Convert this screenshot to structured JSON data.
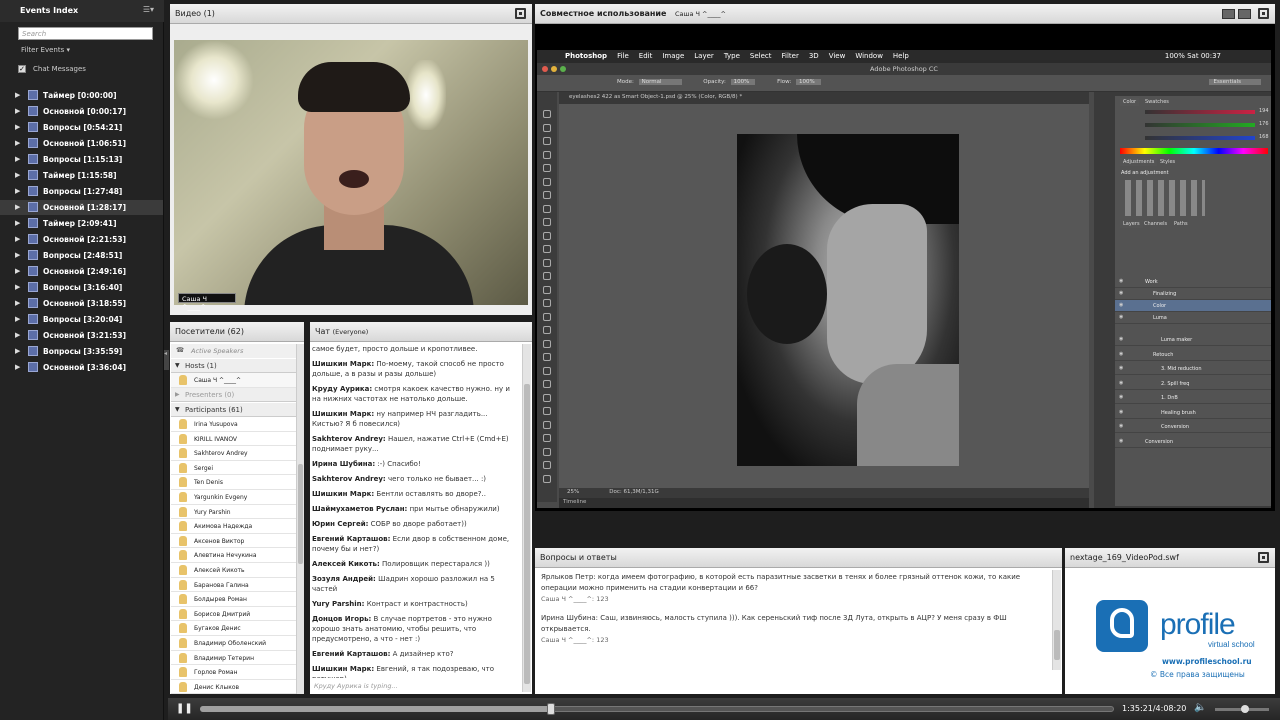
{
  "left_panel": {
    "title": "Events Index",
    "menu_glyph": "☰▾",
    "search_placeholder": "Search",
    "filter_label": "Filter Events",
    "chat_messages_label": "Chat Messages",
    "events": [
      {
        "label": "Таймер [0:00:00]"
      },
      {
        "label": "Основной [0:00:17]"
      },
      {
        "label": "Вопросы [0:54:21]"
      },
      {
        "label": "Основной [1:06:51]"
      },
      {
        "label": "Вопросы [1:15:13]"
      },
      {
        "label": "Таймер [1:15:58]"
      },
      {
        "label": "Вопросы [1:27:48]"
      },
      {
        "label": "Основной [1:28:17]",
        "selected": true
      },
      {
        "label": "Таймер [2:09:41]"
      },
      {
        "label": "Основной [2:21:53]"
      },
      {
        "label": "Вопросы [2:48:51]"
      },
      {
        "label": "Основной [2:49:16]"
      },
      {
        "label": "Вопросы [3:16:40]"
      },
      {
        "label": "Основной [3:18:55]"
      },
      {
        "label": "Вопросы [3:20:04]"
      },
      {
        "label": "Основной [3:21:53]"
      },
      {
        "label": "Вопросы [3:35:59]"
      },
      {
        "label": "Основной [3:36:04]"
      }
    ]
  },
  "video": {
    "title": "Видео",
    "count": "(1)",
    "name_tag": "Саша Ч ^____^"
  },
  "visitors": {
    "title": "Посетители",
    "count": "(62)",
    "active_speakers": "Active Speakers",
    "hosts_label": "Hosts (1)",
    "host": "Саша Ч ^____^",
    "presenters_label": "Presenters (0)",
    "participants_label": "Participants (61)",
    "participants": [
      "Irina Yusupova",
      "KIRILL IVANOV",
      "Sakhterov Andrey",
      "Sergei",
      "Ten Denis",
      "Yargunkin Evgeny",
      "Yury Parshin",
      "Акимова Надежда",
      "Аксенов Виктор",
      "Алевтина Нечукина",
      "Алексей Кикоть",
      "Баранова Галина",
      "Болдырев Роман",
      "Борисов Дмитрий",
      "Бугаков Денис",
      "Владимир Оболенский",
      "Владимир Тетерин",
      "Горлов Роман",
      "Денис Клыков"
    ]
  },
  "chat": {
    "title": "Чат",
    "scope": "(Everyone)",
    "messages": [
      {
        "name": "",
        "text": "самое будет, просто дольше и кропотливее."
      },
      {
        "name": "Шишкин Марк:",
        "text": "По-моему, такой способ не просто дольше, а в разы и разы дольше)"
      },
      {
        "name": "Круду Аурика:",
        "text": "смотря какоек качество нужно. ну и на нижних частотах не натолько дольше."
      },
      {
        "name": "Шишкин Марк:",
        "text": "ну например НЧ разгладить... Кистью? Я б повесился)"
      },
      {
        "name": "Sakhterov Andrey:",
        "text": "Нашел, нажатие Ctrl+E (Cmd+E) поднимает руку..."
      },
      {
        "name": "Ирина Шубина:",
        "text": ":-) Спасибо!"
      },
      {
        "name": "Sakhterov Andrey:",
        "text": "чего только не бывает... :)"
      },
      {
        "name": "Шишкин Марк:",
        "text": "Бентли оставлять во дворе?.."
      },
      {
        "name": "Шаймухаметов Руслан:",
        "text": "при мытье обнаружили)"
      },
      {
        "name": "Юрин Сергей:",
        "text": "СОБР во дворе работает))"
      },
      {
        "name": "Евгений Карташов:",
        "text": "Если двор в собственном доме, почему бы и нет?)"
      },
      {
        "name": "Алексей Кикоть:",
        "text": "Полировщик перестарался ))"
      },
      {
        "name": "Зозуля Андрей:",
        "text": "Шадрин хорошо разложил на 5 частей"
      },
      {
        "name": "Yury Parshin:",
        "text": "Контраст и контрастность)"
      },
      {
        "name": "Донцов Игорь:",
        "text": "В случае портретов - это нужно хорошо знать анатомию, чтобы решить, что предусмотрено, а что - нет :)"
      },
      {
        "name": "Евгений Карташов:",
        "text": "А дизайнер кто?"
      },
      {
        "name": "Шишкин Марк:",
        "text": "Евгений, я так подозреваю, что ретушер)"
      }
    ],
    "typing": "Круду Аурика is typing..."
  },
  "share": {
    "title": "Совместное использование",
    "presenter": "Саша Ч ^____^",
    "ps": {
      "menu": [
        "Photoshop",
        "File",
        "Edit",
        "Image",
        "Layer",
        "Type",
        "Select",
        "Filter",
        "3D",
        "View",
        "Window",
        "Help"
      ],
      "status_right": "100% Sat 00:37",
      "window_title": "Adobe Photoshop CC",
      "doc_tab": "eyelashes2 422 as Smart Object-1.psd @ 25% (Color, RGB/8) *",
      "zoom": "25%",
      "doc_info": "Doc: 61,3M/1,31G",
      "timeline": "Timeline",
      "mode": "Mode:",
      "mode_val": "Normal",
      "opacity": "Opacity:",
      "opacity_val": "100%",
      "flow": "Flow:",
      "flow_val": "100%",
      "essentials": "Essentials",
      "color_tab": "Color",
      "swatches_tab": "Swatches",
      "adjustments_tab": "Adjustments",
      "styles_tab": "Styles",
      "add_adjustment": "Add an adjustment",
      "layers_tab": "Layers",
      "channels_tab": "Channels",
      "paths_tab": "Paths",
      "rgb": [
        "194",
        "176",
        "168"
      ],
      "layers": [
        {
          "name": "Work"
        },
        {
          "name": "Finalizing"
        },
        {
          "name": "Color",
          "selected": true
        },
        {
          "name": "Luma"
        },
        {
          "name": "Luma maker"
        },
        {
          "name": "Retouch"
        },
        {
          "name": "3. Mid reduction"
        },
        {
          "name": "2. Spill freq"
        },
        {
          "name": "1. DnB"
        },
        {
          "name": "Healing brush"
        },
        {
          "name": "Conversion"
        },
        {
          "name": "Conversion"
        }
      ]
    }
  },
  "qa": {
    "title": "Вопросы и ответы",
    "items": [
      {
        "text": "Ярлыков Петр: когда имеем фотографию, в которой есть паразитные засветки в тенях и более грязный оттенок кожи, то какие операции можно применить на стадии конвертации и 66?",
        "sub": "Саша Ч ^____^: 123"
      },
      {
        "text": "Ирина Шубина: Саш, извиняюсь, малость ступила ))). Как сереньский тиф после 3Д Лута, открыть в АЦР? У меня сразу в ФШ открывается.",
        "sub": "Саша Ч ^____^: 123"
      }
    ]
  },
  "swf": {
    "title": "nextage_169_VideoPod.swf",
    "brand": "profile",
    "brand_sub": "virtual school",
    "url": "www.profileschool.ru",
    "copyright": "© Все права защищены"
  },
  "player": {
    "time": "1:35:21/4:08:20",
    "progress": 0.384,
    "volume": 0.55
  },
  "colors": {
    "accent": "#1a6fb5",
    "panel_header": "#e6e6e6",
    "selected_layer": "#5a7090"
  }
}
